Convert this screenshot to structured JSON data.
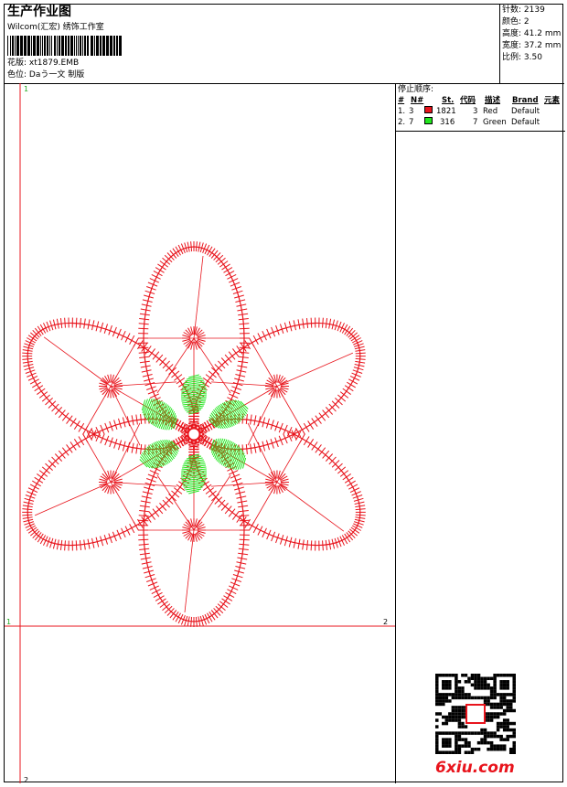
{
  "header": {
    "title": "生产作业图",
    "company": "Wilcom(汇宏) 绣饰工作室",
    "design_label": "花版:",
    "design_file": "xt1879.EMB",
    "colorway_label": "色位:",
    "colorway": "Daう一文 制版"
  },
  "stats": {
    "stitches_label": "针数:",
    "stitches": "2139",
    "colors_label": "颜色:",
    "colors": "2",
    "height_label": "高度:",
    "height": "41.2 mm",
    "width_label": "宽度:",
    "width": "37.2 mm",
    "scale_label": "比例:",
    "scale": "3.50"
  },
  "stop_sequence": {
    "title": "停止顺序:",
    "columns": [
      "#",
      "N#",
      "St.",
      "代码",
      "描述",
      "Brand",
      "元素"
    ],
    "rows": [
      {
        "seq": "1.",
        "needle": "3",
        "color": "#e8141c",
        "stitches": "1821",
        "code": "3",
        "desc": "Red",
        "brand": "Default"
      },
      {
        "seq": "2.",
        "needle": "7",
        "color": "#22e61e",
        "stitches": "316",
        "code": "7",
        "desc": "Green",
        "brand": "Default"
      }
    ]
  },
  "design_colors": {
    "red": "#e8141c",
    "green": "#22e61e"
  },
  "axis_labels": {
    "v_top": "1",
    "v_bottom": "2",
    "h_left": "1",
    "h_right": "2"
  },
  "watermark": {
    "text": "6xiu.com",
    "qr_icon": "qr-code-icon"
  }
}
